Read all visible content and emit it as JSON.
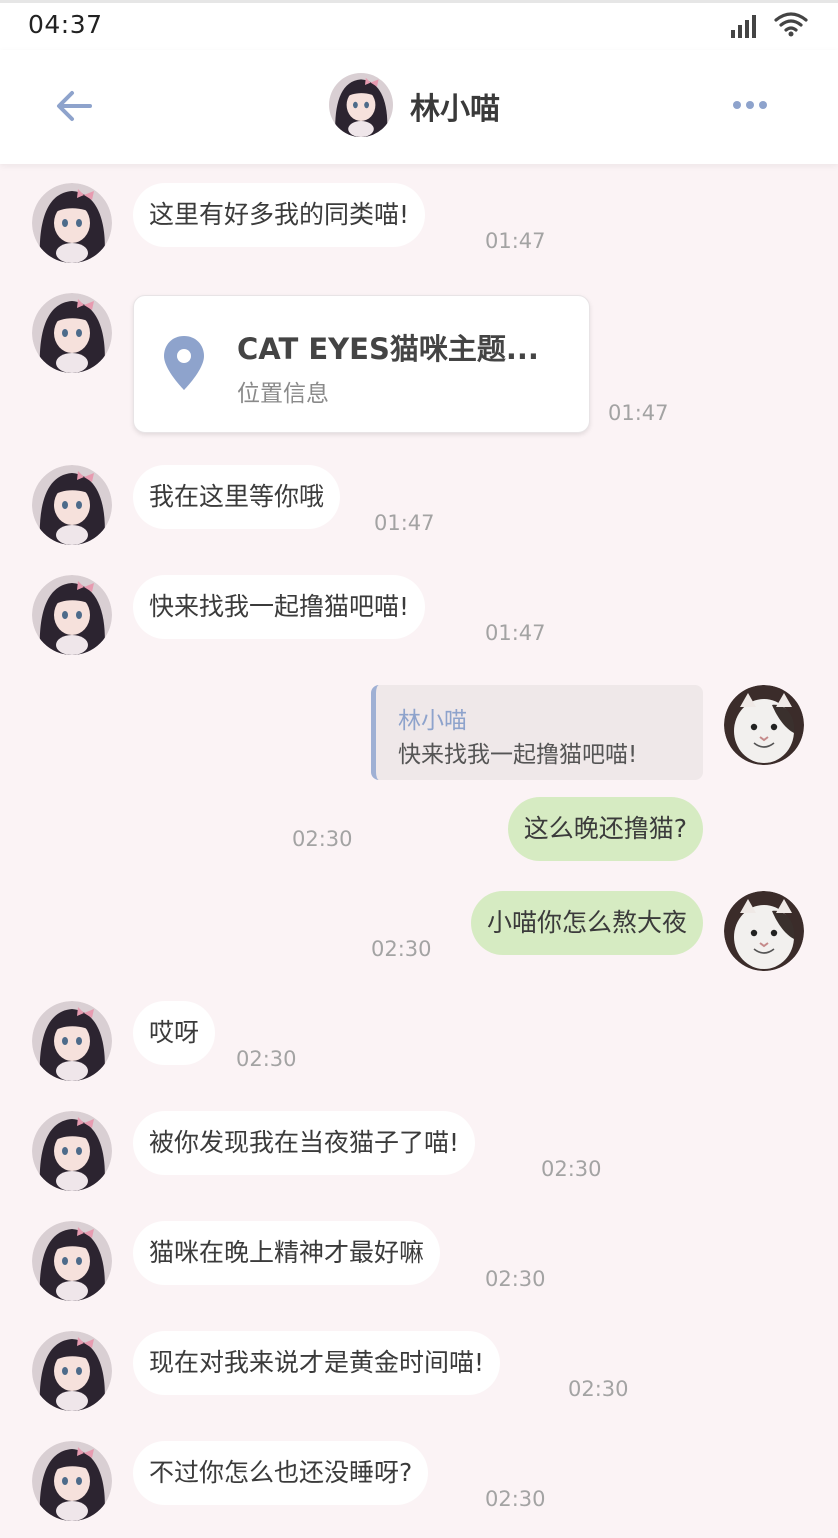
{
  "status_bar": {
    "time": "04:37"
  },
  "header": {
    "title": "林小喵"
  },
  "location": {
    "title": "CAT EYES猫咪主题...",
    "subtitle": "位置信息",
    "time": "01:47"
  },
  "quote": {
    "name": "林小喵",
    "text": "快来找我一起撸猫吧喵!"
  },
  "messages": [
    {
      "text": "这里有好多我的同类喵!",
      "time": "01:47"
    },
    {
      "text": "我在这里等你哦",
      "time": "01:47"
    },
    {
      "text": "快来找我一起撸猫吧喵!",
      "time": "01:47"
    },
    {
      "text": "这么晚还撸猫?",
      "time": "02:30"
    },
    {
      "text": "小喵你怎么熬大夜",
      "time": "02:30"
    },
    {
      "text": "哎呀",
      "time": "02:30"
    },
    {
      "text": "被你发现我在当夜猫子了喵!",
      "time": "02:30"
    },
    {
      "text": "猫咪在晚上精神才最好嘛",
      "time": "02:30"
    },
    {
      "text": "现在对我来说才是黄金时间喵!",
      "time": "02:30"
    },
    {
      "text": "不过你怎么也还没睡呀?",
      "time": "02:30"
    }
  ],
  "colors": {
    "accent": "#8ea3cc",
    "my_bubble": "#d6ebc2",
    "background": "#fbf3f5"
  }
}
